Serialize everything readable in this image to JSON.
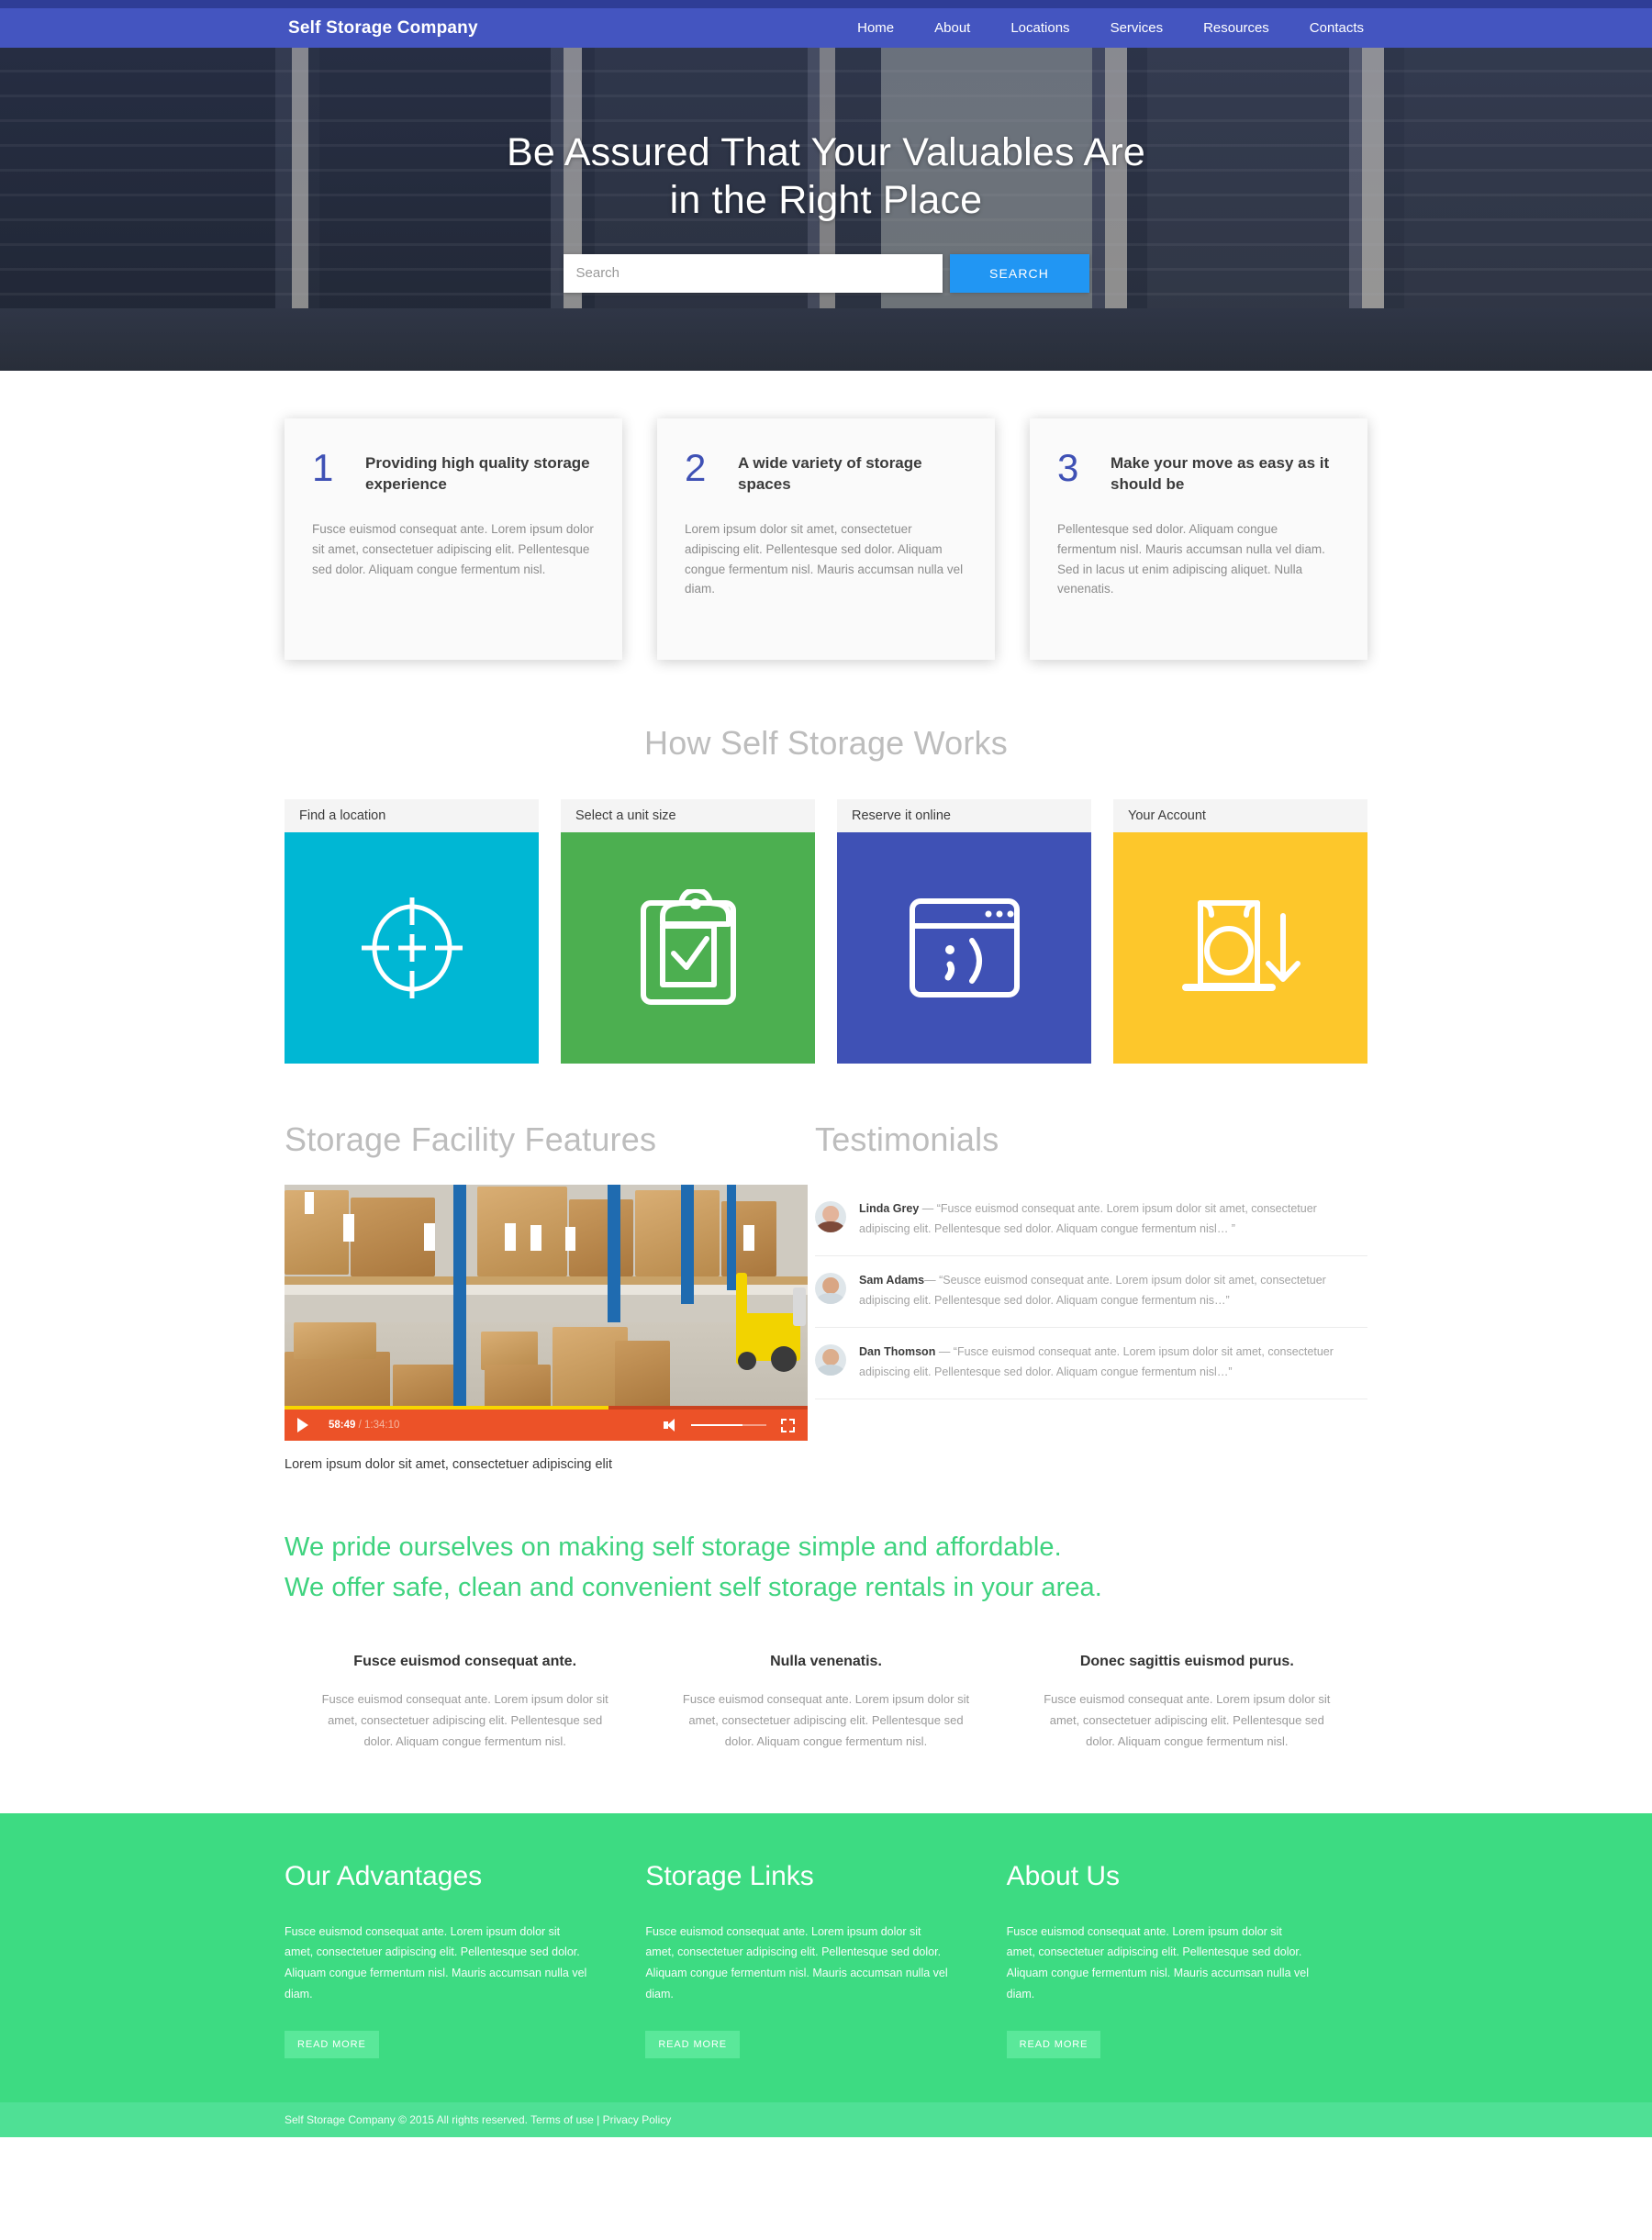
{
  "brand": "Self Storage Company",
  "nav": {
    "items": [
      {
        "label": "Home"
      },
      {
        "label": "About"
      },
      {
        "label": "Locations"
      },
      {
        "label": "Services"
      },
      {
        "label": "Resources"
      },
      {
        "label": "Contacts"
      }
    ]
  },
  "hero": {
    "title_line1": "Be Assured That Your Valuables Are",
    "title_line2": "in the Right Place",
    "search_placeholder": "Search",
    "search_value": "",
    "search_button": "SEARCH"
  },
  "cards": [
    {
      "number": "1",
      "title": "Providing high quality storage experience",
      "body": "Fusce euismod consequat ante. Lorem ipsum dolor sit amet, consectetuer adipiscing elit. Pellentesque sed dolor. Aliquam congue fermentum nisl."
    },
    {
      "number": "2",
      "title": "A wide variety of storage spaces",
      "body": "Lorem ipsum dolor sit amet, consectetuer adipiscing elit. Pellentesque sed dolor. Aliquam congue fermentum nisl. Mauris accumsan nulla vel diam."
    },
    {
      "number": "3",
      "title": "Make your move as easy as it should be",
      "body": "Pellentesque sed dolor. Aliquam congue fermentum nisl. Mauris accumsan nulla vel diam. Sed in lacus ut enim adipiscing aliquet. Nulla venenatis."
    }
  ],
  "how": {
    "title": "How Self Storage Works",
    "tiles": [
      {
        "label": "Find a location",
        "icon": "target-icon",
        "color": "#00b7d4"
      },
      {
        "label": "Select a unit size",
        "icon": "clipboard-check-icon",
        "color": "#4caf50"
      },
      {
        "label": "Reserve it online",
        "icon": "browser-wink-icon",
        "color": "#3f51b5"
      },
      {
        "label": "Your Account",
        "icon": "storage-door-arrow-icon",
        "color": "#fdc72b"
      }
    ]
  },
  "features": {
    "title": "Storage Facility Features",
    "video": {
      "current_time": "58:49",
      "separator": "/",
      "total_time": "1:34:10",
      "play_icon": "play-icon",
      "volume_icon": "volume-icon",
      "fullscreen_icon": "fullscreen-icon"
    },
    "caption": "Lorem ipsum dolor sit amet, consectetuer adipiscing elit"
  },
  "testimonials": {
    "title": "Testimonials",
    "items": [
      {
        "name": "Linda Grey",
        "dash": " — ",
        "quote": "“Fusce euismod consequat ante. Lorem ipsum dolor sit amet, consectetuer adipiscing elit. Pellentesque sed dolor. Aliquam congue fermentum nisl… ”"
      },
      {
        "name": "Sam Adams",
        "dash": "— ",
        "quote": "“Seusce euismod consequat ante. Lorem ipsum dolor sit amet, consectetuer adipiscing elit. Pellentesque sed dolor. Aliquam congue fermentum nis…”"
      },
      {
        "name": "Dan Thomson",
        "dash": " — ",
        "quote": "“Fusce euismod consequat ante. Lorem ipsum dolor sit amet, consectetuer adipiscing elit. Pellentesque sed dolor. Aliquam congue fermentum nisl…”"
      }
    ]
  },
  "tagline": {
    "line1": "We pride ourselves on making self storage simple and affordable.",
    "line2": "We offer safe, clean and convenient self storage rentals in your area.",
    "color": "#3fd37f"
  },
  "tri_columns": [
    {
      "heading": "Fusce euismod consequat ante.",
      "body": "Fusce euismod consequat ante. Lorem ipsum dolor sit amet, consectetuer adipiscing elit. Pellentesque sed dolor. Aliquam congue fermentum nisl."
    },
    {
      "heading": "Nulla venenatis.",
      "body": "Fusce euismod consequat ante. Lorem ipsum dolor sit amet, consectetuer adipiscing elit. Pellentesque sed dolor. Aliquam congue fermentum nisl."
    },
    {
      "heading": "Donec sagittis euismod purus.",
      "body": "Fusce euismod consequat ante. Lorem ipsum dolor sit amet, consectetuer adipiscing elit. Pellentesque sed dolor. Aliquam congue fermentum nisl."
    }
  ],
  "footer": {
    "columns": [
      {
        "title": "Our Advantages",
        "body": "Fusce euismod consequat ante. Lorem ipsum dolor sit amet, consectetuer adipiscing elit. Pellentesque sed dolor. Aliquam congue fermentum nisl. Mauris accumsan nulla vel diam.",
        "button": "READ MORE"
      },
      {
        "title": "Storage Links",
        "body": "Fusce euismod consequat ante. Lorem ipsum dolor sit amet, consectetuer adipiscing elit. Pellentesque sed dolor. Aliquam congue fermentum nisl. Mauris accumsan nulla vel diam.",
        "button": "READ MORE"
      },
      {
        "title": "About Us",
        "body": "Fusce euismod consequat ante. Lorem ipsum dolor sit amet, consectetuer adipiscing elit. Pellentesque sed dolor. Aliquam congue fermentum nisl. Mauris accumsan nulla vel diam.",
        "button": "READ MORE"
      }
    ],
    "copyright": "Self Storage Company © 2015 All rights reserved. Terms of use | Privacy Policy"
  },
  "colors": {
    "nav": "#4455c0",
    "nav_top": "#2f3d96",
    "search_button": "#2196f3",
    "card_number": "#3f51b5",
    "footer_green": "#3ddb82",
    "footer_bar_green": "#4fe095",
    "video_bar": "#ec5228"
  }
}
